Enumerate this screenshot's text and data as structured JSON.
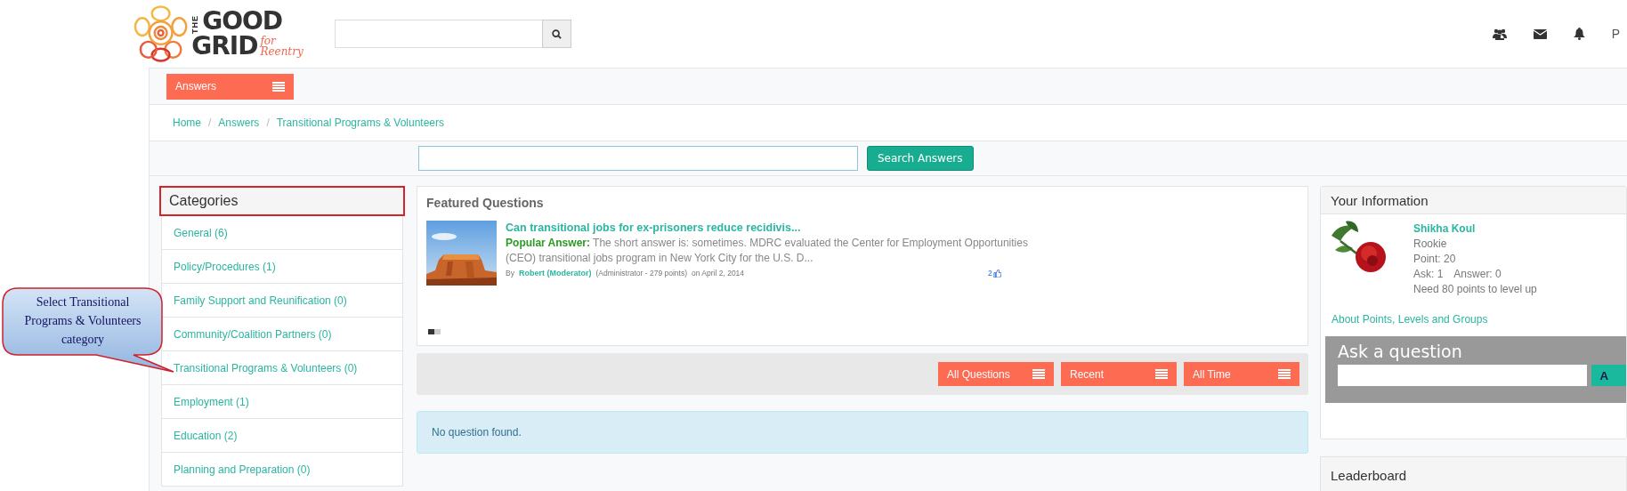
{
  "header": {
    "logo": {
      "the": "THE",
      "good": "GOOD",
      "grid": "GRID",
      "tagline": "for Reentry"
    },
    "user_menu": "P"
  },
  "nav": {
    "answers_button": "Answers"
  },
  "breadcrumb": {
    "separator": "/",
    "items": [
      {
        "label": "Home"
      },
      {
        "label": "Answers"
      },
      {
        "label": "Transitional Programs & Volunteers"
      }
    ]
  },
  "search_answers": {
    "button": "Search Answers"
  },
  "categories": {
    "title": "Categories",
    "items": [
      {
        "label": "General (6)"
      },
      {
        "label": "Policy/Procedures (1)"
      },
      {
        "label": "Family Support and Reunification (0)"
      },
      {
        "label": "Community/Coalition Partners (0)"
      },
      {
        "label": "Transitional Programs & Volunteers (0)"
      },
      {
        "label": "Employment (1)"
      },
      {
        "label": "Education (2)"
      },
      {
        "label": "Planning and Preparation (0)"
      }
    ]
  },
  "callout": {
    "text": "Select Transitional Programs & Volunteers category"
  },
  "featured": {
    "title": "Featured Questions",
    "question": {
      "title": "Can transitional jobs for ex-prisoners reduce recidivis...",
      "answer_label": "Popular Answer:",
      "answer": "The short answer is: sometimes. MDRC evaluated the Center for Employment Opportunities (CEO) transitional jobs program in New York City for the U.S. D...",
      "by": "By",
      "author": "Robert (Moderator)",
      "role": "(Administrator - 279 points)",
      "date": "on April 2, 2014",
      "likes": "2"
    },
    "dots": [
      {
        "selected": true
      },
      {
        "selected": false
      }
    ]
  },
  "filters": [
    {
      "label": "All Questions"
    },
    {
      "label": "Recent"
    },
    {
      "label": "All Time"
    }
  ],
  "empty_message": "No question found.",
  "your_information": {
    "title": "Your Information",
    "name": "Shikha Koul",
    "rank": "Rookie",
    "points": "Point: 20",
    "ask": "Ask: 1",
    "answer": "Answer: 0",
    "level_up": "Need 80 points to level up",
    "link": "About Points, Levels and Groups"
  },
  "ask": {
    "title": "Ask a question",
    "button": "A"
  },
  "leaderboard": {
    "title": "Leaderboard"
  }
}
